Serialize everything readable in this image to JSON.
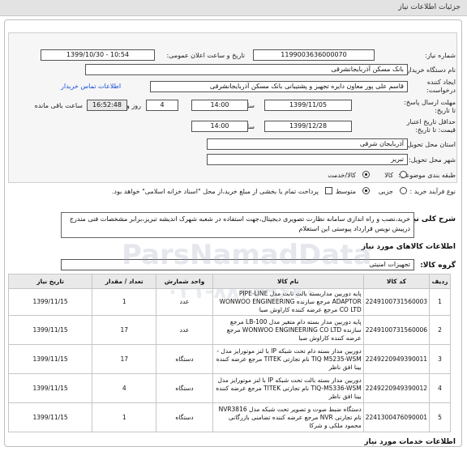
{
  "header": {
    "title": "جزئیات اطلاعات نیاز"
  },
  "form": {
    "need_number_label": "شماره نیاز:",
    "need_number": "1199003636000070",
    "announce_label": "تاریخ و ساعت اعلان عمومی:",
    "announce_value": "1399/10/30 - 10:54",
    "buyer_label": "نام دستگاه خریدار:",
    "buyer": "بانک مسکن آذربایجانشرقی",
    "requester_label_1": "ایجاد کننده",
    "requester_label_2": "درخواست:",
    "requester": "قاسم علی پور معاون دایره تجهیز و پشتیبانی بانک مسکن آذربایجانشرقی",
    "contact_link": "اطلاعات تماس خریدار",
    "reply_label_1": "مهلت ارسال پاسخ:",
    "reply_label_2": "تا تاریخ:",
    "reply_date": "1399/11/05",
    "time_label": "ساعت",
    "reply_time": "14:00",
    "days_value": "4",
    "days_label": "روز و",
    "remaining_time": "16:52:48",
    "remaining_label": "ساعت باقی مانده",
    "validity_label_1": "حداقل تاریخ اعتبار",
    "validity_label_2": "قیمت: تا تاریخ:",
    "validity_date": "1399/12/28",
    "validity_time": "14:00",
    "province_label": "استان محل تحویل:",
    "province": "آذربایجان شرقی",
    "city_label": "شهر محل تحویل:",
    "city": "تبریز",
    "category_label": "طبقه بندی موضوعی:",
    "category_goods": "کالا",
    "category_service": "کالا/خدمت",
    "process_label": "نوع فرآیند خرید :",
    "process_partial": "جزیی",
    "process_medium": "متوسط",
    "payment_note": "پرداخت تمام یا بخشی از مبلغ خرید،از محل \"اسناد خزانه اسلامی\" خواهد بود."
  },
  "description": {
    "label": "شرح کلی نیاز:",
    "text": "خرید،نصب و راه اندازی سامانه نظارت تصویری دیجیتال،جهت استفاده در شعبه شهرک اندیشه تبریز،برابر مشخصات فنی مندرج درپیش نویس قرارداد پیوستی این استعلام"
  },
  "goods": {
    "section_title": "اطلاعات کالاهای مورد نیاز",
    "group_label": "گروه کالا:",
    "group_value": "تجهیزات امنیتی",
    "headers": [
      "ردیف",
      "کد کالا",
      "نام کالا",
      "واحد شمارش",
      "تعداد / مقدار",
      "تاریخ نیاز"
    ],
    "rows": [
      {
        "n": "1",
        "code": "2249100731560003",
        "name": "پایه دوربین مداربسته بالت ثابت مدل PIPE-LINE ADAPTOR مرجع سازنده WONWOO ENGINEERING CO LTD مرجع عرضه کننده کاراوش صبا",
        "unit": "عدد",
        "qty": "1",
        "date": "1399/11/15"
      },
      {
        "n": "2",
        "code": "2249100731560006",
        "name": "پایه دوربین مدار بسته دام متغیر مدل LB-100 مرجع سازنده WONWOO ENGINEERING CO LTD مرجع عرضه کننده کاراوش صبا",
        "unit": "عدد",
        "qty": "17",
        "date": "1399/11/15"
      },
      {
        "n": "3",
        "code": "2249220949390011",
        "name": "دوربین مدار بسته دام تحت شبکه IP با لنز موتورایز مدل -TIQ M5235-WSM نام تجارتی TITEK مرجع عرضه کننده بینا افق ناظر",
        "unit": "دستگاه",
        "qty": "17",
        "date": "1399/11/15"
      },
      {
        "n": "4",
        "code": "2249220949390012",
        "name": "دوربین مدار بسته بالت تحت شبکه IP با لنز موتورایز مدل TIQ-M5336-WSM نام تجارتی TITEK مرجع عرضه کننده بینا افق ناظر",
        "unit": "دستگاه",
        "qty": "4",
        "date": "1399/11/15"
      },
      {
        "n": "5",
        "code": "2241300476090001",
        "name": "دستگاه ضبط صوت و تصویر تحت شبکه مدل NVR3816 نام تجارتی NVR مرجع عرضه کننده تضامنی بازرگانی محمود ملکی و شرکا",
        "unit": "دستگاه",
        "qty": "1",
        "date": "1399/11/15"
      }
    ]
  },
  "services": {
    "section_title": "اطلاعات خدمات مورد نیاز"
  },
  "watermark": {
    "line1": "ParsNamadData",
    "line2": "۰۲۱-۸۸۳۴۹۶۷۰"
  },
  "colors": {
    "link": "#1a4fd6",
    "topbar": "#e3e3e3",
    "panel": "#f6f6f6"
  }
}
